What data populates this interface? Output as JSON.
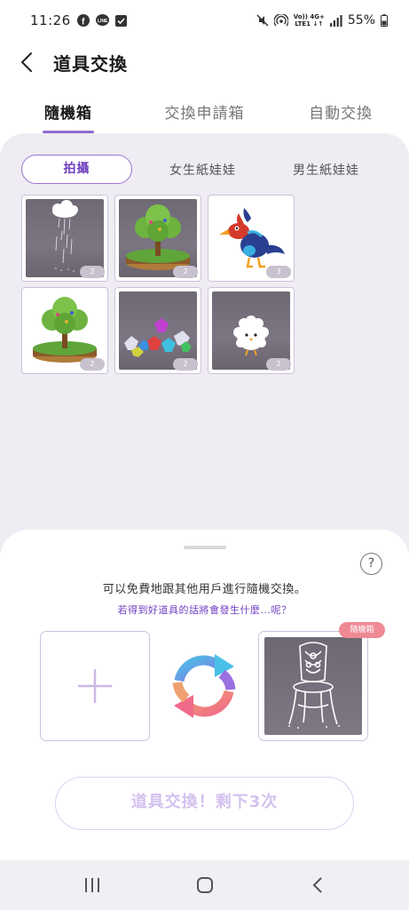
{
  "status_bar": {
    "time": "11:26",
    "network_top": "Vo)) 4G+",
    "network_bottom": "LTE1 ↓↑",
    "battery": "55%",
    "icons": [
      "facebook-icon",
      "line-icon",
      "checkbox-icon",
      "mute-icon",
      "hotspot-icon",
      "signal-icon",
      "battery-icon"
    ]
  },
  "header": {
    "title": "道具交換",
    "back_icon": "chevron-left-icon"
  },
  "tabs": [
    {
      "label": "隨機箱",
      "active": true
    },
    {
      "label": "交換申請箱",
      "active": false
    },
    {
      "label": "自動交換",
      "active": false
    }
  ],
  "sub_tabs": [
    {
      "label": "拍攝",
      "active": true
    },
    {
      "label": "女生紙娃娃",
      "active": false
    },
    {
      "label": "男生紙娃娃",
      "active": false
    }
  ],
  "items": [
    {
      "name": "rain-cloud",
      "count": "2",
      "bg": "dark"
    },
    {
      "name": "tree-island",
      "count": "2",
      "bg": "dark"
    },
    {
      "name": "blue-bird-creature",
      "count": "3",
      "bg": "light"
    },
    {
      "name": "tree-island",
      "count": "2",
      "bg": "light"
    },
    {
      "name": "gems-pile",
      "count": "2",
      "bg": "dark"
    },
    {
      "name": "white-fluffy-chick",
      "count": "2",
      "bg": "dark"
    }
  ],
  "exchange": {
    "help_label": "?",
    "info_text": "可以免費地跟其他用戶進行隨機交換。",
    "info_link": "若得到好道具的話將會發生什麼...呢？",
    "random_badge": "隨機箱",
    "button_label": "道具交換！剩下3次",
    "remaining": 3
  },
  "colors": {
    "accent": "#8e6ccf",
    "accent_text": "#6f3fc0",
    "content_bg": "#efecf3",
    "badge_pink": "#ef8a95",
    "button_text_disabled": "#d3c1ee"
  },
  "nav": [
    "recent-apps-icon",
    "home-icon",
    "back-icon"
  ]
}
